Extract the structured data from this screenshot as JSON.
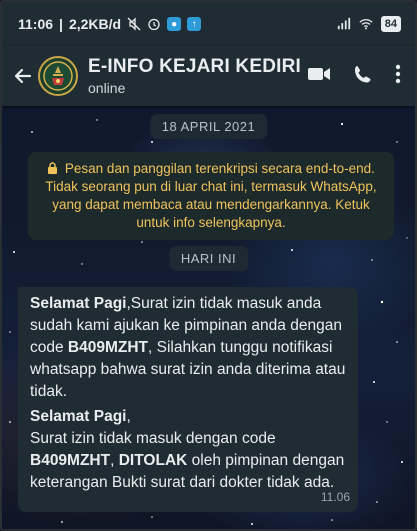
{
  "status_bar": {
    "time": "11:06",
    "separator": "|",
    "speed": "2,2KB/d",
    "battery": "84"
  },
  "header": {
    "contact_name": "E-INFO KEJARI KEDIRI",
    "status": "online"
  },
  "chat": {
    "date_label": "18 APRIL 2021",
    "encryption_notice": "Pesan dan panggilan terenkripsi secara end-to-end. Tidak seorang pun di luar chat ini, termasuk WhatsApp, yang dapat membaca atau mendengarkannya. Ketuk untuk info selengkapnya.",
    "today_label": "HARI INI",
    "messages": [
      {
        "part1_bold": "Selamat Pagi",
        "part2": ",Surat izin tidak masuk anda sudah kami ajukan ke pimpinan anda dengan code ",
        "part3_bold": "B409MZHT",
        "part4": ", Silahkan tunggu notifikasi whatsapp bahwa surat izin anda diterima atau tidak.",
        "time": "11.06"
      },
      {
        "part1_bold": "Selamat Pagi",
        "part2": ",",
        "part3": "Surat izin tidak masuk dengan code",
        "part4_bold": "B409MZHT",
        "part5": ", ",
        "part6_bold": "DITOLAK",
        "part7": " oleh pimpinan dengan keterangan Bukti surat dari dokter tidak ada.",
        "time": "11.06"
      }
    ]
  },
  "icons": [
    "back-arrow-icon",
    "avatar-emblem",
    "video-call-icon",
    "phone-icon",
    "more-icon",
    "lock-icon",
    "mute-icon",
    "alarm-icon",
    "wifi-icon",
    "signal-icon"
  ],
  "colors": {
    "bar": "#1f2c34",
    "bubble": "#202c33",
    "notice_text": "#f0c25a"
  }
}
